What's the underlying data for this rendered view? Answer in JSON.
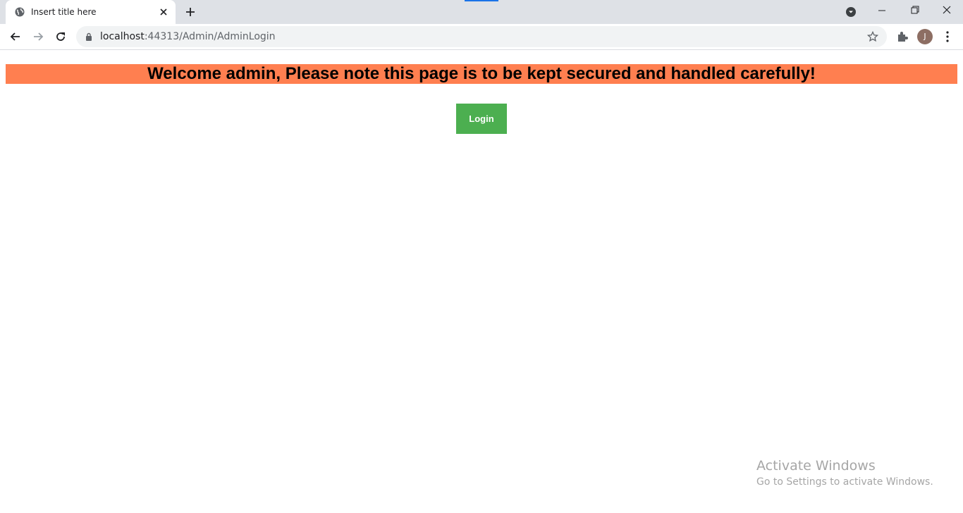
{
  "browser": {
    "tab_title": "Insert title here",
    "url_host": "localhost",
    "url_rest": ":44313/Admin/AdminLogin",
    "profile_initial": "J"
  },
  "page": {
    "banner_text": "Welcome admin, Please note this page is to be kept secured and handled carefully!",
    "login_label": "Login",
    "banner_color": "#ff7f50",
    "button_color": "#4caf50"
  },
  "watermark": {
    "title": "Activate Windows",
    "subtitle": "Go to Settings to activate Windows."
  }
}
